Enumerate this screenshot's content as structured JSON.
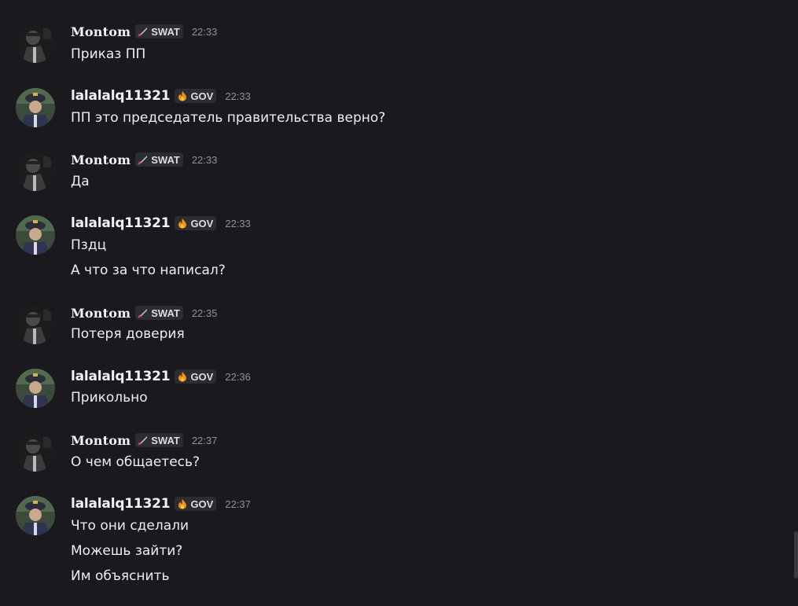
{
  "users": {
    "monton": {
      "name": "Montom",
      "badge": "SWAT",
      "badge_icon": "sword-icon"
    },
    "gov": {
      "name": "lalalalq11321",
      "badge": "GOV",
      "badge_icon": "fire-icon"
    }
  },
  "messages": [
    {
      "time": "22:33",
      "lines": [
        "Приказ ПП"
      ]
    },
    {
      "time": "22:33",
      "lines": [
        "ПП это председатель правительства верно?"
      ]
    },
    {
      "time": "22:33",
      "lines": [
        "Да"
      ]
    },
    {
      "time": "22:33",
      "lines": [
        "Пздц",
        "А что за что написал?"
      ]
    },
    {
      "time": "22:35",
      "lines": [
        "Потеря доверия"
      ]
    },
    {
      "time": "22:36",
      "lines": [
        "Прикольно"
      ]
    },
    {
      "time": "22:37",
      "lines": [
        "О чем общаетесь?"
      ]
    },
    {
      "time": "22:37",
      "lines": [
        "Что они сделали",
        "Можешь зайти?",
        "Им объяснить"
      ]
    }
  ],
  "colors": {
    "background": "#1a1a1e",
    "badge_bg": "#2c2d32",
    "timestamp": "#8e9297"
  }
}
